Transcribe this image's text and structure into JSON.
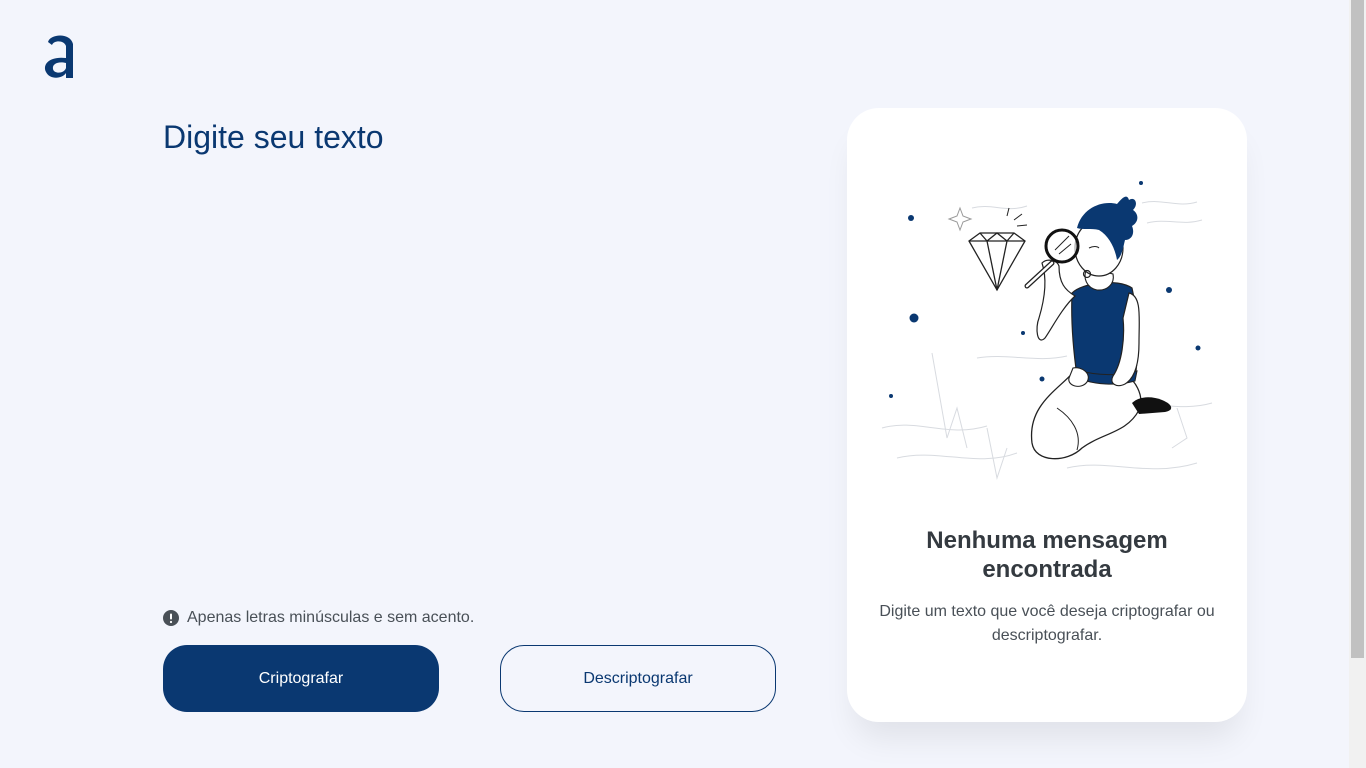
{
  "logo": {
    "icon": "alura-a-logo"
  },
  "editor": {
    "placeholder": "Digite seu texto"
  },
  "hint": {
    "icon": "exclamation-circle-icon",
    "text": "Apenas letras minúsculas e sem acento."
  },
  "buttons": {
    "encrypt_label": "Criptografar",
    "decrypt_label": "Descriptografar"
  },
  "result": {
    "illustration": "person-with-magnifying-glass-illustration",
    "title": "Nenhuma mensagem encontrada",
    "description": "Digite um texto que você deseja criptografar ou descriptografar."
  },
  "colors": {
    "primary": "#0a3871",
    "background": "#f3f5fc",
    "card": "#ffffff",
    "text_dark": "#343a40",
    "text_gray": "#495057"
  }
}
